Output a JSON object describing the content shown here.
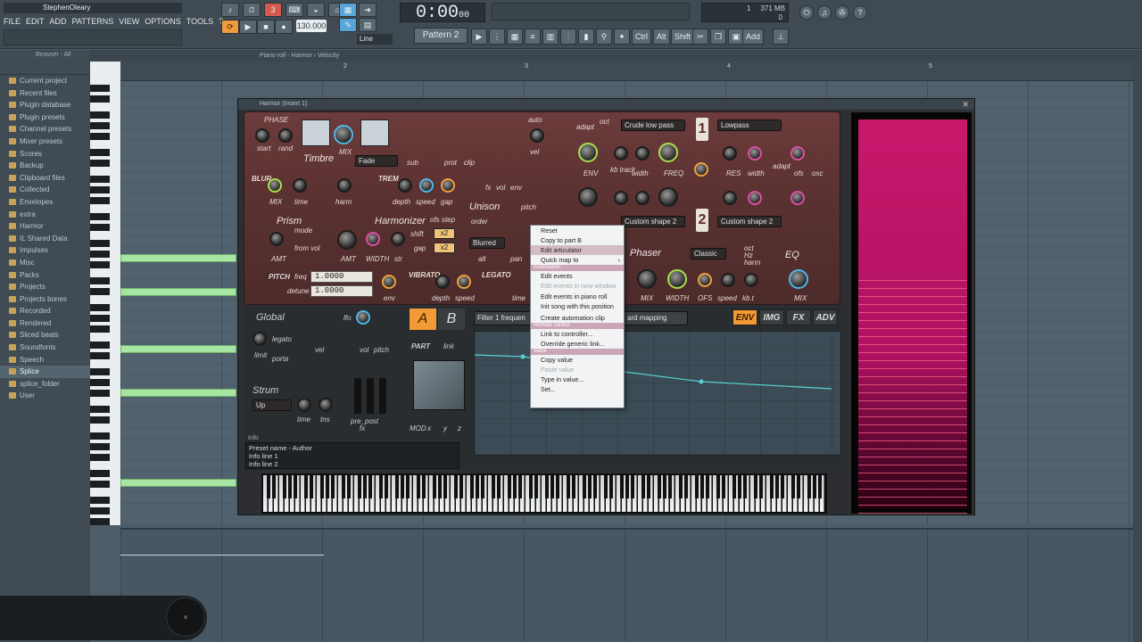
{
  "app": {
    "window_title": "StephenOleary"
  },
  "menu": [
    "FILE",
    "EDIT",
    "ADD",
    "PATTERNS",
    "VIEW",
    "OPTIONS",
    "TOOLS",
    "?"
  ],
  "transport": {
    "time": "0:00",
    "time_sub": "00",
    "bpm": "130.000",
    "pattern": "Pattern 2",
    "snap": "Line"
  },
  "toolbar": {
    "ctrl": "Ctrl",
    "alt": "Alt",
    "shift": "Shift",
    "add": "Add"
  },
  "memory": {
    "count": "1",
    "mem": "371 MB",
    "voices": "0"
  },
  "browser": {
    "header": "Browser - All",
    "items": [
      "Current project",
      "Recent files",
      "Plugin database",
      "Plugin presets",
      "Channel presets",
      "Mixer presets",
      "Scores",
      "Backup",
      "Clipboard files",
      "Collected",
      "Envelopes",
      "extra",
      "Harmor",
      "IL Shared Data",
      "Impulses",
      "Misc",
      "Packs",
      "Projects",
      "Projects bones",
      "Recorded",
      "Rendered",
      "Sliced beats",
      "Soundfonts",
      "Speech",
      "Splice",
      "splice_folder",
      "User"
    ],
    "selected": "Splice"
  },
  "pianoroll": {
    "breadcrumb": "Piano roll - Harmor › Velocity",
    "bars": [
      "2",
      "3",
      "4",
      "5"
    ]
  },
  "harmor": {
    "title": "Harmor (Insert 1)",
    "labels": {
      "phase": "PHASE",
      "start": "start",
      "rand": "rand",
      "timbre": "Timbre",
      "mix": "MIX",
      "fade": "Fade",
      "sub": "sub",
      "prot": "prot",
      "clip": "clip",
      "fx": "fx",
      "vol": "vol",
      "env": "env",
      "auto": "auto",
      "vel": "vel",
      "adapt": "adapt",
      "oct": "oct",
      "hz": "Hz",
      "filter1": "Crude low pass",
      "filter2": "Lowpass",
      "env_k": "ENV",
      "kb_track": "kb track",
      "width": "width",
      "freq": "FREQ",
      "res": "RES",
      "ofs": "ofs",
      "osc": "osc",
      "blur": "BLUR",
      "time": "time",
      "harm": "harm",
      "trem": "TREM",
      "depth": "depth",
      "speed": "speed",
      "gap": "gap",
      "unison": "Unison",
      "order": "order",
      "pitch": "pitch",
      "blurred": "Blurred",
      "alt": "alt",
      "pan": "pan",
      "prism": "Prism",
      "mode": "mode",
      "from_vol": "from vol",
      "amt": "AMT",
      "harmonizer": "Harmonizer",
      "ofs_step": "ofs step",
      "width_k": "WIDTH",
      "str": "str",
      "shift": "shift",
      "gap2": "gap",
      "x2a": "x2",
      "x2b": "x2",
      "custom1": "Custom shape 2",
      "custom2": "Custom shape 2",
      "phaser": "Phaser",
      "classic": "Classic",
      "eq": "EQ",
      "pitch_lbl": "PITCH",
      "freq_l": "freq",
      "detune": "detune",
      "val1": "1.0000",
      "val2": "1.0000",
      "vibrato": "VIBRATO",
      "legato": "LEGATO",
      "mix2": "MIX",
      "width2": "WIDTH",
      "ofs2": "OFS",
      "speed2": "speed",
      "kbt": "kb.t",
      "harm2": "harm",
      "global": "Global",
      "lfo": "lfo",
      "legato2": "legato",
      "limit": "limit",
      "porta": "porta",
      "vel2": "vel",
      "vol2": "vol",
      "pitch2": "pitch",
      "strum": "Strum",
      "up": "Up",
      "time2": "time",
      "tns": "tns",
      "pre_post": "pre_post",
      "fx2": "fx",
      "part": "PART",
      "link": "link",
      "mod": "MOD",
      "x": "x",
      "y": "y",
      "z": "z",
      "a": "A",
      "b": "B",
      "filter_freq": "Filter 1 frequen",
      "kbd_mapping": "ard mapping",
      "tab_env": "ENV",
      "tab_img": "IMG",
      "tab_fx": "FX",
      "tab_adv": "ADV"
    },
    "info": {
      "title": "Info",
      "line0": "Preset name - Author",
      "line1": "Info line 1",
      "line2": "Info line 2"
    }
  },
  "context_menu": [
    {
      "label": "Reset",
      "type": "item"
    },
    {
      "label": "Copy to part B",
      "type": "item"
    },
    {
      "label": "Edit articulator",
      "type": "item",
      "highlight": true
    },
    {
      "label": "Quick map to",
      "type": "item",
      "arrow": "›"
    },
    {
      "label": "Automation",
      "type": "header"
    },
    {
      "label": "Edit events",
      "type": "item"
    },
    {
      "label": "Edit events in new window",
      "type": "disabled"
    },
    {
      "label": "Edit events in piano roll",
      "type": "item"
    },
    {
      "label": "Init song with this position",
      "type": "item"
    },
    {
      "label": "",
      "type": "sep"
    },
    {
      "label": "Create automation clip",
      "type": "item"
    },
    {
      "label": "Remote control",
      "type": "header"
    },
    {
      "label": "Link to controller...",
      "type": "item"
    },
    {
      "label": "Override generic link...",
      "type": "item"
    },
    {
      "label": "Value",
      "type": "header"
    },
    {
      "label": "Copy value",
      "type": "item"
    },
    {
      "label": "Paste value",
      "type": "disabled"
    },
    {
      "label": "Type in value...",
      "type": "item"
    },
    {
      "label": "Set...",
      "type": "item"
    }
  ],
  "colors": {
    "accent": "#f09a3c",
    "note": "#a7e6a2",
    "spectrum": "#c8186c",
    "panel": "#6d3c3c"
  }
}
